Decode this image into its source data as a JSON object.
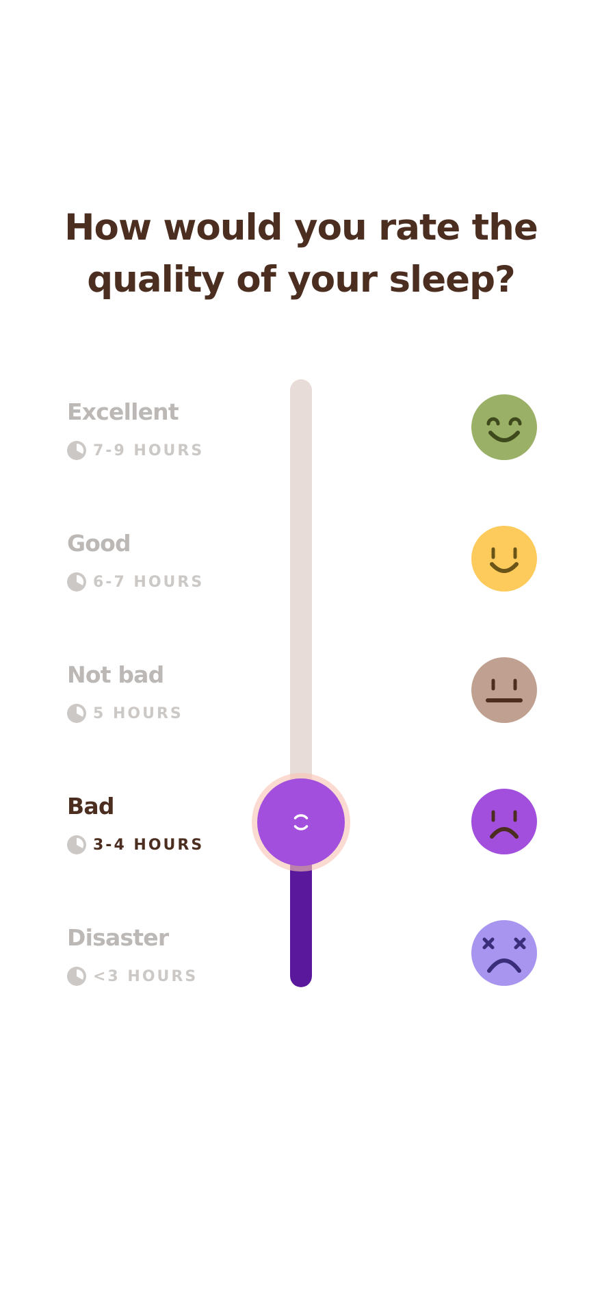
{
  "question": {
    "line1": "How would you rate the",
    "line2": "quality of your sleep?"
  },
  "options": [
    {
      "label": "Excellent",
      "hours": "7-9 HOURS",
      "face_icon": "very-happy-face-icon",
      "face_color": "#9bb067"
    },
    {
      "label": "Good",
      "hours": "6-7 HOURS",
      "face_icon": "happy-face-icon",
      "face_color": "#fdca5c"
    },
    {
      "label": "Not bad",
      "hours": "5 HOURS",
      "face_icon": "neutral-face-icon",
      "face_color": "#c0a090"
    },
    {
      "label": "Bad",
      "hours": "3-4 HOURS",
      "face_icon": "sad-face-icon",
      "face_color": "#a24fdd"
    },
    {
      "label": "Disaster",
      "hours": "<3 HOURS",
      "face_icon": "dizzy-face-icon",
      "face_color": "#a795f0"
    }
  ],
  "selected_index": 3,
  "slider": {
    "track_color": "#e8dcd8",
    "fill_color": "#5a189d",
    "thumb_color": "#a24fdd",
    "halo_color": "#f9c4b4",
    "thumb_icon": "drag-handle-icon"
  },
  "colors": {
    "title": "#4b2e20",
    "label_inactive": "#bcb8b6",
    "label_active": "#4b2e20"
  }
}
